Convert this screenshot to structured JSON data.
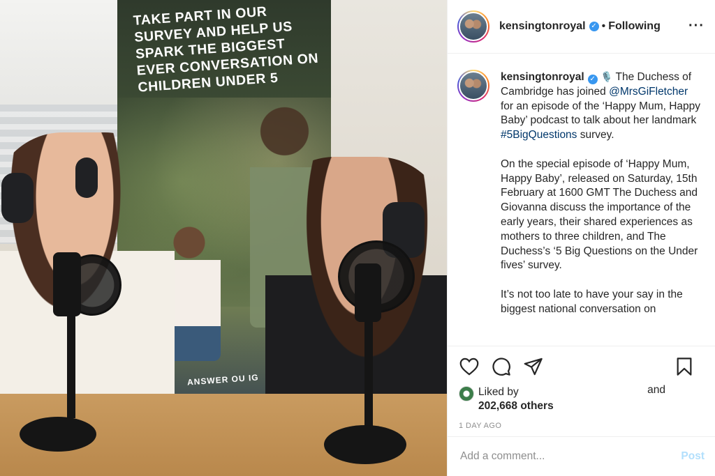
{
  "photo": {
    "banner_text": "TAKE PART IN OUR SURVEY AND HELP US SPARK THE BIGGEST EVER CONVERSATION ON CHILDREN UNDER 5",
    "banner_footer": "ANSWER OU  IG"
  },
  "header": {
    "username": "kensingtonroyal",
    "separator": "•",
    "follow_status": "Following",
    "more_icon": "···"
  },
  "caption": {
    "username": "kensingtonroyal",
    "emoji": "🎙️",
    "part1": " The Duchess of Cambridge has joined ",
    "mention": "@MrsGiFletcher",
    "part2": " for an episode of the ‘Happy Mum, Happy Baby’ podcast to talk about her landmark ",
    "hashtag": "#5BigQuestions",
    "part3": " survey.",
    "para2": "On the special episode of ‘Happy Mum, Happy Baby’, released on Saturday, 15th February at 1600 GMT The Duchess and Giovanna discuss the importance of the early years, their shared experiences as mothers to three children, and The Duchess’s ‘5 Big Questions on the Under fives’ survey.",
    "para3": "It’s not too late to have your say in the biggest national conversation on"
  },
  "actions": {
    "icons": [
      "heart-icon",
      "comment-icon",
      "share-icon",
      "bookmark-icon"
    ]
  },
  "likes": {
    "liked_by": "Liked by",
    "and": "and",
    "count": "202,668 others"
  },
  "time_ago": "1 DAY AGO",
  "comment": {
    "placeholder": "Add a comment...",
    "post_label": "Post"
  },
  "colors": {
    "link": "#00376b",
    "verified": "#3897f0",
    "post_disabled": "#b2dffc",
    "muted": "#8e8e8e"
  }
}
